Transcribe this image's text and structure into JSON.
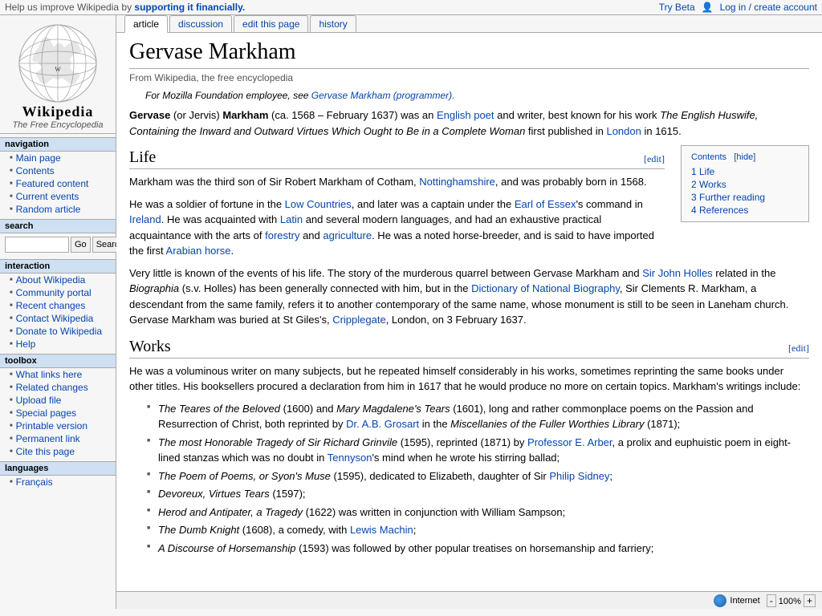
{
  "topbar": {
    "help_text": "Help us improve Wikipedia by",
    "help_link_text": "supporting it financially.",
    "try_beta": "Try Beta",
    "login_label": "Log in / create account"
  },
  "logo": {
    "title": "Wikipedia",
    "subtitle": "The Free Encyclopedia"
  },
  "navigation": {
    "title": "navigation",
    "items": [
      {
        "label": "Main page",
        "href": "#"
      },
      {
        "label": "Contents",
        "href": "#"
      },
      {
        "label": "Featured content",
        "href": "#"
      },
      {
        "label": "Current events",
        "href": "#"
      },
      {
        "label": "Random article",
        "href": "#"
      }
    ]
  },
  "search": {
    "title": "search",
    "go_label": "Go",
    "search_label": "Search",
    "placeholder": ""
  },
  "interaction": {
    "title": "interaction",
    "items": [
      {
        "label": "About Wikipedia",
        "href": "#"
      },
      {
        "label": "Community portal",
        "href": "#"
      },
      {
        "label": "Recent changes",
        "href": "#"
      },
      {
        "label": "Contact Wikipedia",
        "href": "#"
      },
      {
        "label": "Donate to Wikipedia",
        "href": "#"
      },
      {
        "label": "Help",
        "href": "#"
      }
    ]
  },
  "toolbox": {
    "title": "toolbox",
    "items": [
      {
        "label": "What links here",
        "href": "#"
      },
      {
        "label": "Related changes",
        "href": "#"
      },
      {
        "label": "Upload file",
        "href": "#"
      },
      {
        "label": "Special pages",
        "href": "#"
      },
      {
        "label": "Printable version",
        "href": "#"
      },
      {
        "label": "Permanent link",
        "href": "#"
      },
      {
        "label": "Cite this page",
        "href": "#"
      }
    ]
  },
  "languages": {
    "title": "languages",
    "items": [
      {
        "label": "Français",
        "href": "#"
      }
    ]
  },
  "tabs": [
    {
      "label": "article",
      "active": true
    },
    {
      "label": "discussion",
      "active": false
    },
    {
      "label": "edit this page",
      "active": false
    },
    {
      "label": "history",
      "active": false
    }
  ],
  "article": {
    "title": "Gervase Markham",
    "source": "From Wikipedia, the free encyclopedia",
    "hatnote": "For Mozilla Foundation employee, see",
    "hatnote_link": "Gervase Markham (programmer).",
    "intro": "Gervase (or Jervis) Markham (ca. 1568 – February 1637) was an English poet and writer, best known for his work The English Huswife, Containing the Inward and Outward Virtues Which Ought to Be in a Complete Woman first published in London in 1615.",
    "contents": {
      "header": "Contents",
      "hide_label": "[hide]",
      "items": [
        {
          "num": "1",
          "label": "Life"
        },
        {
          "num": "2",
          "label": "Works"
        },
        {
          "num": "3",
          "label": "Further reading"
        },
        {
          "num": "4",
          "label": "References"
        }
      ]
    },
    "sections": [
      {
        "id": "life",
        "title": "Life",
        "edit_label": "[edit]",
        "paragraphs": [
          "Markham was the third son of Sir Robert Markham of Cotham, Nottinghamshire, and was probably born in 1568.",
          "He was a soldier of fortune in the Low Countries, and later was a captain under the Earl of Essex's command in Ireland. He was acquainted with Latin and several modern languages, and had an exhaustive practical acquaintance with the arts of forestry and agriculture. He was a noted horse-breeder, and is said to have imported the first Arabian horse.",
          "Very little is known of the events of his life. The story of the murderous quarrel between Gervase Markham and Sir John Holles related in the Biographia (s.v. Holles) has been generally connected with him, but in the Dictionary of National Biography, Sir Clements R. Markham, a descendant from the same family, refers it to another contemporary of the same name, whose monument is still to be seen in Laneham church. Gervase Markham was buried at St Giles's, Cripplegate, London, on 3 February 1637."
        ]
      },
      {
        "id": "works",
        "title": "Works",
        "edit_label": "[edit]",
        "intro": "He was a voluminous writer on many subjects, but he repeated himself considerably in his works, sometimes reprinting the same books under other titles. His booksellers procured a declaration from him in 1617 that he would produce no more on certain topics. Markham's writings include:",
        "list_items": [
          "The Teares of the Beloved (1600) and Mary Magdalene's Tears (1601), long and rather commonplace poems on the Passion and Resurrection of Christ, both reprinted by Dr. A.B. Grosart in the Miscellanies of the Fuller Worthies Library (1871);",
          "The most Honorable Tragedy of Sir Richard Grinvile (1595), reprinted (1871) by Professor E. Arber, a prolix and euphuistic poem in eight-lined stanzas which was no doubt in Tennyson's mind when he wrote his stirring ballad;",
          "The Poem of Poems, or Syon's Muse (1595), dedicated to Elizabeth, daughter of Sir Philip Sidney;",
          "Devoreux, Virtues Tears (1597);",
          "Herod and Antipater, a Tragedy (1622) was written in conjunction with William Sampson;",
          "The Dumb Knight (1608), a comedy, with Lewis Machin;",
          "A Discourse of Horsemanship (1593) was followed by other popular treatises on horsemanship and farriery;"
        ]
      }
    ]
  },
  "statusbar": {
    "internet_label": "Internet",
    "zoom_label": "100%"
  }
}
